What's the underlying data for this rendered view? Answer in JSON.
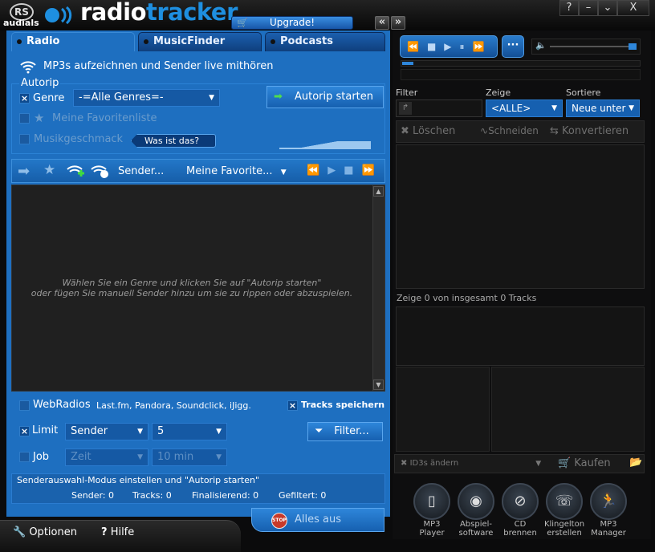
{
  "app": {
    "brand_small": "RS",
    "brand_audials": "audials",
    "brand_radio": "radio",
    "brand_tracker": "tracker",
    "upgrade": "Upgrade!"
  },
  "window": {
    "help": "?",
    "minimize": "–",
    "collapse": "⌄",
    "close": "X"
  },
  "tabs": [
    "Radio",
    "MusicFinder",
    "Podcasts"
  ],
  "radio": {
    "intro": "MP3s aufzeichnen und Sender live mithören",
    "autorip_group": "Autorip",
    "genre_label": "Genre",
    "genre_value": "-=Alle Genres=-",
    "autorip_button": "Autorip starten",
    "favorites_label": "Meine Favoritenliste",
    "taste_label": "Musikgeschmack",
    "what_is_that": "Was ist das?",
    "toolbar_sender": "Sender...",
    "toolbar_favorites": "Meine Favorite...",
    "empty_line1": "Wählen Sie ein Genre und klicken Sie auf \"Autorip starten\"",
    "empty_line2": "oder fügen Sie manuell Sender hinzu um sie zu rippen oder abzuspielen.",
    "webradios_label": "WebRadios",
    "webradios_sources": "Last.fm, Pandora, Soundclick, iJigg.",
    "save_tracks": "Tracks speichern",
    "limit_label": "Limit",
    "limit_type": "Sender",
    "limit_value": "5",
    "filter_button": "Filter...",
    "job_label": "Job",
    "job_type": "Zeit",
    "job_value": "10 min",
    "status_text": "Senderauswahl-Modus einstellen und \"Autorip starten\"",
    "stats": {
      "sender": "Sender: 0",
      "tracks": "Tracks: 0",
      "finalizing": "Finalisierend: 0",
      "filtered": "Gefiltert: 0"
    },
    "all_off": "Alles aus",
    "stop": "STOP"
  },
  "bottom": {
    "options": "Optionen",
    "help": "Hilfe"
  },
  "right": {
    "filter_label": "Filter",
    "show_label": "Zeige",
    "show_value": "<ALLE>",
    "sort_label": "Sortiere",
    "sort_value": "Neue unter",
    "delete": "Löschen",
    "cut": "Schneiden",
    "convert": "Konvertieren",
    "count_text": "Zeige 0 von insgesamt 0 Tracks",
    "id3": "ID3s ändern",
    "buy": "Kaufen",
    "tools": [
      {
        "l1": "MP3",
        "l2": "Player"
      },
      {
        "l1": "Abspiel-",
        "l2": "software"
      },
      {
        "l1": "CD",
        "l2": "brennen"
      },
      {
        "l1": "Klingelton",
        "l2": "erstellen"
      },
      {
        "l1": "MP3",
        "l2": "Manager"
      }
    ]
  },
  "colors": {
    "panel_blue": "#1e6fc0",
    "accent": "#1e8fe0",
    "dark": "#0e0e0f"
  }
}
